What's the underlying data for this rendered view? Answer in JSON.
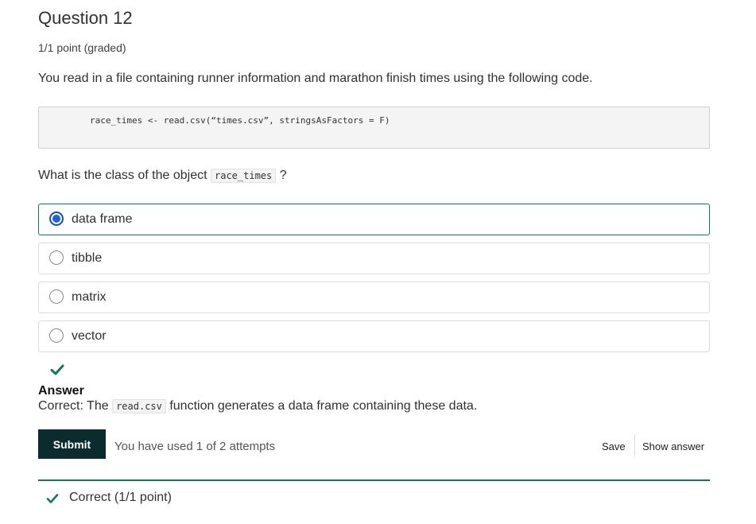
{
  "question": {
    "title": "Question 12",
    "points": "1/1 point (graded)",
    "text": "You read in a file containing runner information and marathon finish times using the following code.",
    "code": "race_times <- read.csv(“times.csv”, stringsAsFactors = F)",
    "prompt_before": "What is the class of the object",
    "prompt_code": "race_times",
    "prompt_after": "?"
  },
  "options": [
    {
      "label": "data frame",
      "selected": true
    },
    {
      "label": "tibble",
      "selected": false
    },
    {
      "label": "matrix",
      "selected": false
    },
    {
      "label": "vector",
      "selected": false
    }
  ],
  "answer": {
    "heading": "Answer",
    "prefix": "Correct:  The",
    "code": "read.csv",
    "suffix": "function generates a data frame containing these data."
  },
  "actions": {
    "submit_label": "Submit",
    "attempts_text": "You have used 1 of 2 attempts",
    "save_label": "Save",
    "show_answer_label": "Show answer"
  },
  "notification": {
    "text": "Correct (1/1 point)"
  },
  "colors": {
    "success": "#127a5a",
    "submit_bg": "#0b2c2f",
    "radio_selected": "#1a62e8"
  }
}
